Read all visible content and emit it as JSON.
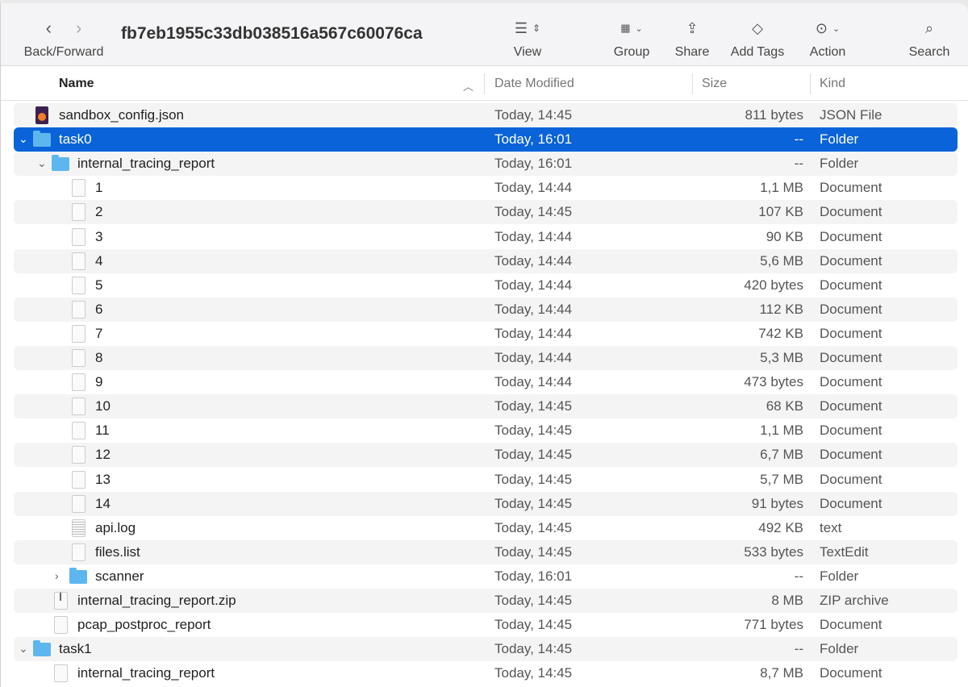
{
  "toolbar": {
    "back_forward": "Back/Forward",
    "title": "fb7eb1955c33db038516a567c60076ca",
    "view": "View",
    "group": "Group",
    "share": "Share",
    "add_tags": "Add Tags",
    "action": "Action",
    "search": "Search"
  },
  "columns": {
    "name": "Name",
    "date": "Date Modified",
    "size": "Size",
    "kind": "Kind"
  },
  "rows": [
    {
      "name": "sandbox_config.json",
      "date": "Today, 14:45",
      "size": "811 bytes",
      "kind": "JSON File",
      "level": 0,
      "icon": "json",
      "chev": ""
    },
    {
      "name": "task0",
      "date": "Today, 16:01",
      "size": "--",
      "kind": "Folder",
      "level": 0,
      "icon": "folder",
      "chev": "open",
      "selected": true
    },
    {
      "name": "internal_tracing_report",
      "date": "Today, 16:01",
      "size": "--",
      "kind": "Folder",
      "level": 1,
      "icon": "folder",
      "chev": "open"
    },
    {
      "name": "1",
      "date": "Today, 14:44",
      "size": "1,1 MB",
      "kind": "Document",
      "level": 2,
      "icon": "doc"
    },
    {
      "name": "2",
      "date": "Today, 14:45",
      "size": "107 KB",
      "kind": "Document",
      "level": 2,
      "icon": "doc"
    },
    {
      "name": "3",
      "date": "Today, 14:44",
      "size": "90 KB",
      "kind": "Document",
      "level": 2,
      "icon": "doc"
    },
    {
      "name": "4",
      "date": "Today, 14:44",
      "size": "5,6 MB",
      "kind": "Document",
      "level": 2,
      "icon": "doc"
    },
    {
      "name": "5",
      "date": "Today, 14:44",
      "size": "420 bytes",
      "kind": "Document",
      "level": 2,
      "icon": "doc"
    },
    {
      "name": "6",
      "date": "Today, 14:44",
      "size": "112 KB",
      "kind": "Document",
      "level": 2,
      "icon": "doc"
    },
    {
      "name": "7",
      "date": "Today, 14:44",
      "size": "742 KB",
      "kind": "Document",
      "level": 2,
      "icon": "doc"
    },
    {
      "name": "8",
      "date": "Today, 14:44",
      "size": "5,3 MB",
      "kind": "Document",
      "level": 2,
      "icon": "doc"
    },
    {
      "name": "9",
      "date": "Today, 14:44",
      "size": "473 bytes",
      "kind": "Document",
      "level": 2,
      "icon": "doc"
    },
    {
      "name": "10",
      "date": "Today, 14:45",
      "size": "68 KB",
      "kind": "Document",
      "level": 2,
      "icon": "doc"
    },
    {
      "name": "11",
      "date": "Today, 14:45",
      "size": "1,1 MB",
      "kind": "Document",
      "level": 2,
      "icon": "doc"
    },
    {
      "name": "12",
      "date": "Today, 14:45",
      "size": "6,7 MB",
      "kind": "Document",
      "level": 2,
      "icon": "doc"
    },
    {
      "name": "13",
      "date": "Today, 14:45",
      "size": "5,7 MB",
      "kind": "Document",
      "level": 2,
      "icon": "doc"
    },
    {
      "name": "14",
      "date": "Today, 14:45",
      "size": "91 bytes",
      "kind": "Document",
      "level": 2,
      "icon": "doc"
    },
    {
      "name": "api.log",
      "date": "Today, 14:45",
      "size": "492 KB",
      "kind": "text",
      "level": 2,
      "icon": "log"
    },
    {
      "name": "files.list",
      "date": "Today, 14:45",
      "size": "533 bytes",
      "kind": "TextEdit",
      "level": 2,
      "icon": "doc"
    },
    {
      "name": "scanner",
      "date": "Today, 16:01",
      "size": "--",
      "kind": "Folder",
      "level": 2,
      "icon": "folder",
      "chev": "closed"
    },
    {
      "name": "internal_tracing_report.zip",
      "date": "Today, 14:45",
      "size": "8 MB",
      "kind": "ZIP archive",
      "level": 1,
      "icon": "zip"
    },
    {
      "name": "pcap_postproc_report",
      "date": "Today, 14:45",
      "size": "771 bytes",
      "kind": "Document",
      "level": 1,
      "icon": "doc"
    },
    {
      "name": "task1",
      "date": "Today, 14:45",
      "size": "--",
      "kind": "Folder",
      "level": 0,
      "icon": "folder",
      "chev": "open"
    },
    {
      "name": "internal_tracing_report",
      "date": "Today, 14:45",
      "size": "8,7 MB",
      "kind": "Document",
      "level": 1,
      "icon": "doc"
    }
  ]
}
